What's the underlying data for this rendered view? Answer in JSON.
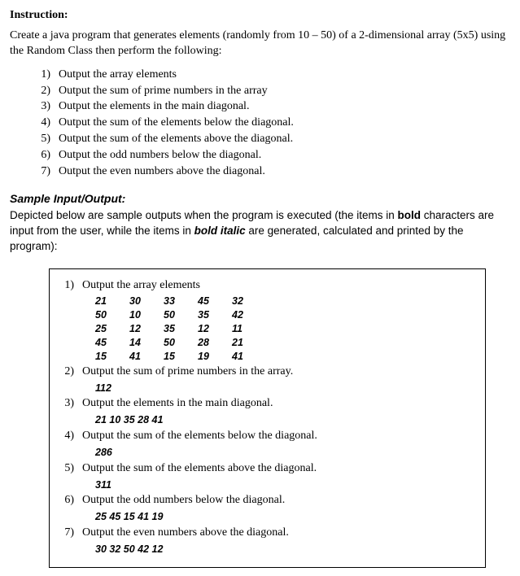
{
  "heading": "Instruction:",
  "intro": "Create a java program that generates elements (randomly from 10 – 50) of a 2-dimensional array (5x5) using the Random Class then perform the following:",
  "instructions": [
    "Output the array elements",
    "Output the sum of prime numbers in the array",
    "Output the elements in the main diagonal.",
    "Output the sum of the elements below the diagonal.",
    "Output the sum of the elements above the diagonal.",
    "Output the odd numbers below the diagonal.",
    "Output the even numbers above the diagonal."
  ],
  "sample_heading": "Sample Input/Output:",
  "sample_desc_1": "Depicted below are sample outputs when the program is executed (the items in ",
  "sample_desc_bold": "bold",
  "sample_desc_2": " characters are input from the user, while the items in ",
  "sample_desc_bi": "bold italic",
  "sample_desc_3": " are generated, calculated and printed by the program):",
  "box": {
    "items": [
      {
        "num": "1)",
        "label": "Output the array elements"
      },
      {
        "num": "2)",
        "label": "Output the sum of prime numbers in the array."
      },
      {
        "num": "3)",
        "label": "Output the elements in the main diagonal."
      },
      {
        "num": "4)",
        "label": "Output the sum of the elements below the diagonal."
      },
      {
        "num": "5)",
        "label": "Output the sum of the elements above the diagonal."
      },
      {
        "num": "6)",
        "label": "Output the odd numbers below the diagonal."
      },
      {
        "num": "7)",
        "label": "Output the even numbers above the diagonal."
      }
    ],
    "array": [
      [
        "21",
        "30",
        "33",
        "45",
        "32"
      ],
      [
        "50",
        "10",
        "50",
        "35",
        "42"
      ],
      [
        "25",
        "12",
        "35",
        "12",
        "11"
      ],
      [
        "45",
        "14",
        "50",
        "28",
        "21"
      ],
      [
        "15",
        "41",
        "15",
        "19",
        "41"
      ]
    ],
    "results": {
      "prime_sum": "112",
      "main_diag": "21 10 35 28 41",
      "below_sum": "286",
      "above_sum": "311",
      "odd_below": "25 45 15 41 19",
      "even_above": "30 32 50 42 12"
    }
  }
}
